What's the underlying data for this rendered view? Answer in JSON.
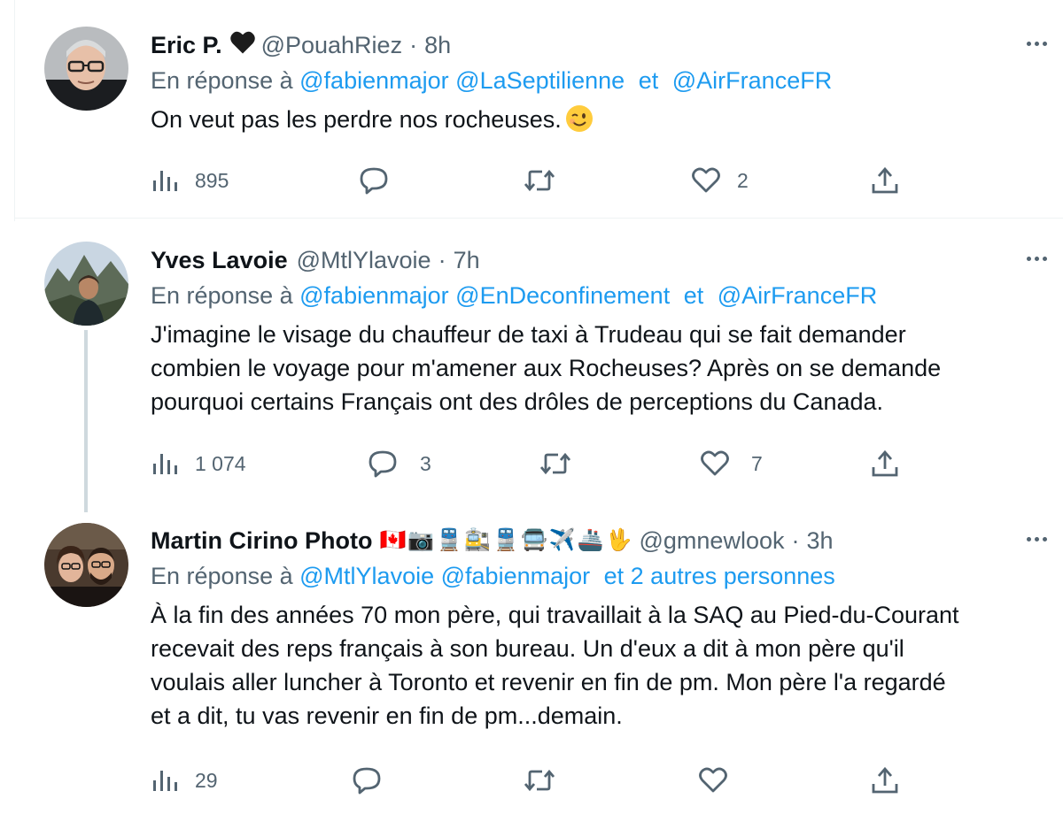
{
  "tweets": [
    {
      "name": "Eric P.",
      "badge": "black-heart",
      "handle": "@PouahRiez",
      "sep": "·",
      "time": "8h",
      "reply_prefix": "En réponse à",
      "mentions": [
        "@fabienmajor",
        "@LaSeptilienne"
      ],
      "conjunction": "et",
      "last_mention": "@AirFranceFR",
      "text": "On veut pas les perdre nos rocheuses.",
      "text_emoji": "winking-face-icon",
      "views": "895",
      "replies": "",
      "retweets": "",
      "likes": "2"
    },
    {
      "name": "Yves Lavoie",
      "handle": "@MtlYlavoie",
      "sep": "·",
      "time": "7h",
      "reply_prefix": "En réponse à",
      "mentions": [
        "@fabienmajor",
        "@EnDeconfinement"
      ],
      "conjunction": "et",
      "last_mention": "@AirFranceFR",
      "text": "J'imagine le visage du chauffeur de taxi à Trudeau qui se fait demander\ncombien le voyage pour m'amener aux Rocheuses?  Après on se demande\npourquoi certains Français ont des drôles de perceptions du Canada.",
      "views": "1 074",
      "replies": "3",
      "retweets": "",
      "likes": "7"
    },
    {
      "name": "Martin Cirino Photo",
      "name_emojis": [
        "🇨🇦",
        "📷",
        "🚆",
        "🚉",
        "🚆",
        "🚍",
        "✈️",
        "🚢",
        "🖖"
      ],
      "handle": "@gmnewlook",
      "sep": "·",
      "time": "3h",
      "reply_prefix": "En réponse à",
      "mentions": [
        "@MtlYlavoie",
        "@fabienmajor"
      ],
      "conjunction": "",
      "last_mention": "et 2 autres personnes",
      "text": "À la fin des années 70 mon père, qui travaillait à la SAQ au Pied-du-Courant\nrecevait des reps français à son bureau. Un d'eux a dit à mon père qu'il\nvoulais aller luncher à Toronto et revenir en fin de pm. Mon père l'a regardé\net a dit, tu vas revenir en fin de pm...demain.",
      "views": "29",
      "replies": "",
      "retweets": "",
      "likes": ""
    }
  ],
  "colors": {
    "accent": "#1d9bf0",
    "secondary_text": "#536471",
    "primary_text": "#0f1419",
    "thread_line": "#cfd9de"
  },
  "icons": {
    "views": "bar-chart-icon",
    "reply": "speech-bubble-icon",
    "retweet": "retweet-icon",
    "like": "heart-icon",
    "share": "share-icon",
    "more": "more-dots-icon"
  }
}
